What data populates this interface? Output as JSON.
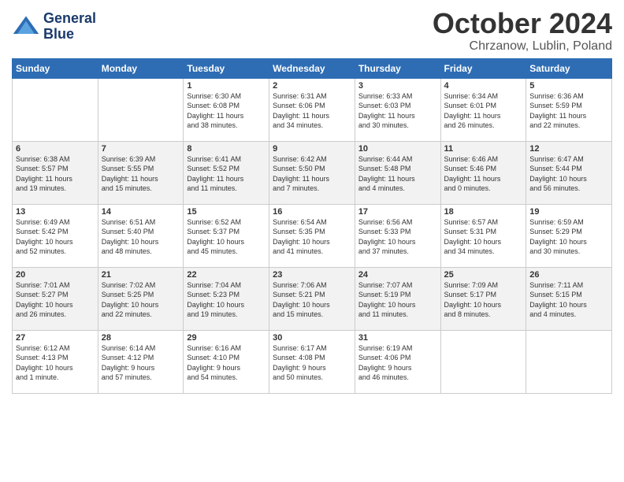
{
  "header": {
    "logo_line1": "General",
    "logo_line2": "Blue",
    "month": "October 2024",
    "location": "Chrzanow, Lublin, Poland"
  },
  "days_of_week": [
    "Sunday",
    "Monday",
    "Tuesday",
    "Wednesday",
    "Thursday",
    "Friday",
    "Saturday"
  ],
  "weeks": [
    [
      {
        "day": "",
        "info": ""
      },
      {
        "day": "",
        "info": ""
      },
      {
        "day": "1",
        "info": "Sunrise: 6:30 AM\nSunset: 6:08 PM\nDaylight: 11 hours\nand 38 minutes."
      },
      {
        "day": "2",
        "info": "Sunrise: 6:31 AM\nSunset: 6:06 PM\nDaylight: 11 hours\nand 34 minutes."
      },
      {
        "day": "3",
        "info": "Sunrise: 6:33 AM\nSunset: 6:03 PM\nDaylight: 11 hours\nand 30 minutes."
      },
      {
        "day": "4",
        "info": "Sunrise: 6:34 AM\nSunset: 6:01 PM\nDaylight: 11 hours\nand 26 minutes."
      },
      {
        "day": "5",
        "info": "Sunrise: 6:36 AM\nSunset: 5:59 PM\nDaylight: 11 hours\nand 22 minutes."
      }
    ],
    [
      {
        "day": "6",
        "info": "Sunrise: 6:38 AM\nSunset: 5:57 PM\nDaylight: 11 hours\nand 19 minutes."
      },
      {
        "day": "7",
        "info": "Sunrise: 6:39 AM\nSunset: 5:55 PM\nDaylight: 11 hours\nand 15 minutes."
      },
      {
        "day": "8",
        "info": "Sunrise: 6:41 AM\nSunset: 5:52 PM\nDaylight: 11 hours\nand 11 minutes."
      },
      {
        "day": "9",
        "info": "Sunrise: 6:42 AM\nSunset: 5:50 PM\nDaylight: 11 hours\nand 7 minutes."
      },
      {
        "day": "10",
        "info": "Sunrise: 6:44 AM\nSunset: 5:48 PM\nDaylight: 11 hours\nand 4 minutes."
      },
      {
        "day": "11",
        "info": "Sunrise: 6:46 AM\nSunset: 5:46 PM\nDaylight: 11 hours\nand 0 minutes."
      },
      {
        "day": "12",
        "info": "Sunrise: 6:47 AM\nSunset: 5:44 PM\nDaylight: 10 hours\nand 56 minutes."
      }
    ],
    [
      {
        "day": "13",
        "info": "Sunrise: 6:49 AM\nSunset: 5:42 PM\nDaylight: 10 hours\nand 52 minutes."
      },
      {
        "day": "14",
        "info": "Sunrise: 6:51 AM\nSunset: 5:40 PM\nDaylight: 10 hours\nand 48 minutes."
      },
      {
        "day": "15",
        "info": "Sunrise: 6:52 AM\nSunset: 5:37 PM\nDaylight: 10 hours\nand 45 minutes."
      },
      {
        "day": "16",
        "info": "Sunrise: 6:54 AM\nSunset: 5:35 PM\nDaylight: 10 hours\nand 41 minutes."
      },
      {
        "day": "17",
        "info": "Sunrise: 6:56 AM\nSunset: 5:33 PM\nDaylight: 10 hours\nand 37 minutes."
      },
      {
        "day": "18",
        "info": "Sunrise: 6:57 AM\nSunset: 5:31 PM\nDaylight: 10 hours\nand 34 minutes."
      },
      {
        "day": "19",
        "info": "Sunrise: 6:59 AM\nSunset: 5:29 PM\nDaylight: 10 hours\nand 30 minutes."
      }
    ],
    [
      {
        "day": "20",
        "info": "Sunrise: 7:01 AM\nSunset: 5:27 PM\nDaylight: 10 hours\nand 26 minutes."
      },
      {
        "day": "21",
        "info": "Sunrise: 7:02 AM\nSunset: 5:25 PM\nDaylight: 10 hours\nand 22 minutes."
      },
      {
        "day": "22",
        "info": "Sunrise: 7:04 AM\nSunset: 5:23 PM\nDaylight: 10 hours\nand 19 minutes."
      },
      {
        "day": "23",
        "info": "Sunrise: 7:06 AM\nSunset: 5:21 PM\nDaylight: 10 hours\nand 15 minutes."
      },
      {
        "day": "24",
        "info": "Sunrise: 7:07 AM\nSunset: 5:19 PM\nDaylight: 10 hours\nand 11 minutes."
      },
      {
        "day": "25",
        "info": "Sunrise: 7:09 AM\nSunset: 5:17 PM\nDaylight: 10 hours\nand 8 minutes."
      },
      {
        "day": "26",
        "info": "Sunrise: 7:11 AM\nSunset: 5:15 PM\nDaylight: 10 hours\nand 4 minutes."
      }
    ],
    [
      {
        "day": "27",
        "info": "Sunrise: 6:12 AM\nSunset: 4:13 PM\nDaylight: 10 hours\nand 1 minute."
      },
      {
        "day": "28",
        "info": "Sunrise: 6:14 AM\nSunset: 4:12 PM\nDaylight: 9 hours\nand 57 minutes."
      },
      {
        "day": "29",
        "info": "Sunrise: 6:16 AM\nSunset: 4:10 PM\nDaylight: 9 hours\nand 54 minutes."
      },
      {
        "day": "30",
        "info": "Sunrise: 6:17 AM\nSunset: 4:08 PM\nDaylight: 9 hours\nand 50 minutes."
      },
      {
        "day": "31",
        "info": "Sunrise: 6:19 AM\nSunset: 4:06 PM\nDaylight: 9 hours\nand 46 minutes."
      },
      {
        "day": "",
        "info": ""
      },
      {
        "day": "",
        "info": ""
      }
    ]
  ]
}
